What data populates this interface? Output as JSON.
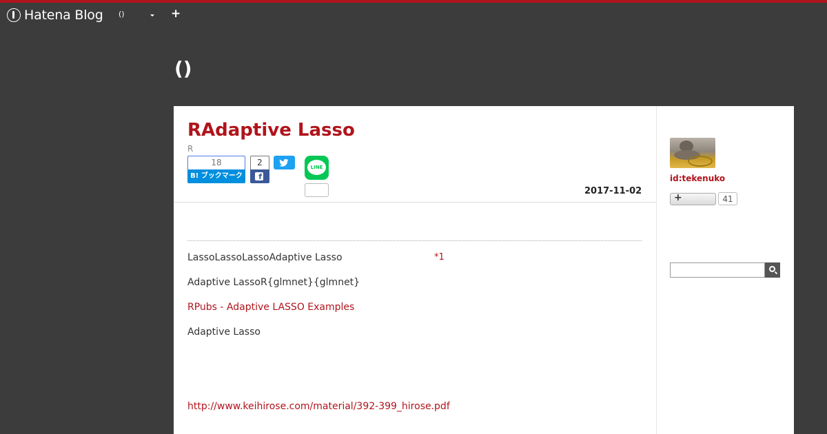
{
  "navbar": {
    "brand": "Hatena Blog",
    "blog_selector": "()",
    "add_label": "+"
  },
  "blog": {
    "title": "()"
  },
  "entry": {
    "title": "RAdaptive Lasso",
    "category": "R",
    "hatena_bookmark": {
      "count": "18",
      "label": "B! ブックマーク"
    },
    "facebook": {
      "count": "2",
      "icon": "f"
    },
    "line": {
      "label": "LINE"
    },
    "date": "2017-11-02",
    "paragraphs": {
      "p1": "LassoLassoLassoAdaptive Lasso",
      "footnote": "*1",
      "p2": "Adaptive LassoR{glmnet}{glmnet}",
      "link1": "RPubs - Adaptive LASSO Examples",
      "p3": "Adaptive Lasso",
      "link2": "http://www.keihirose.com/material/392-399_hirose.pdf"
    }
  },
  "sidebar": {
    "user_id": "id:tekenuko",
    "follow_label": "+",
    "follower_count": "41",
    "search_placeholder": ""
  },
  "colors": {
    "accent": "#b0141c",
    "background": "#3c3c3c",
    "hatena_blue": "#008fde",
    "facebook_blue": "#3b5998",
    "twitter_blue": "#1da1f2",
    "line_green": "#06c755"
  },
  "icons": {
    "logo": "hatena-pen-icon",
    "twitter": "twitter-bird-icon",
    "search": "magnifier-icon",
    "dropdown": "chevron-down-icon"
  }
}
